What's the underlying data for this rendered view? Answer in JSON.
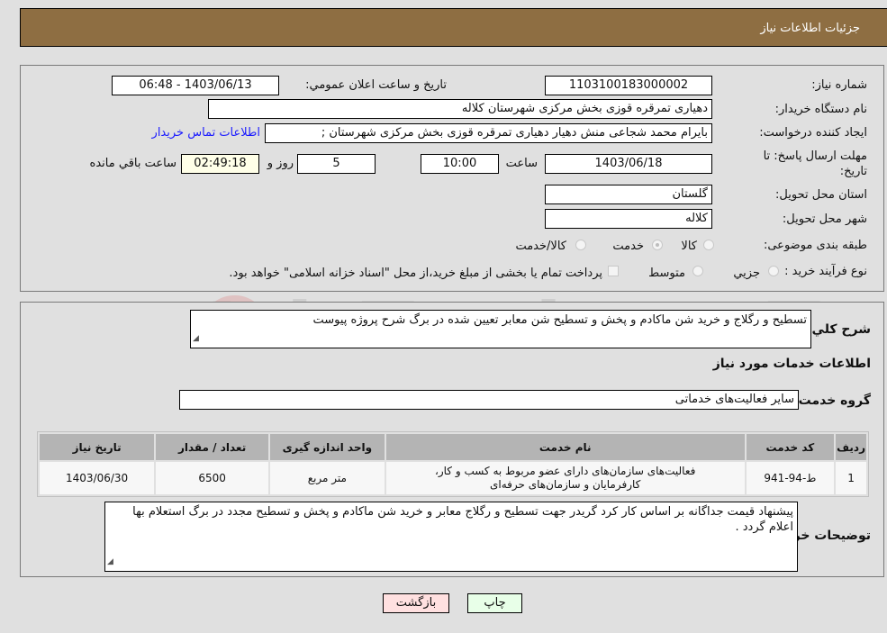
{
  "header": {
    "title": "جزئیات اطلاعات نیاز"
  },
  "info": {
    "need_number_label": "شماره نیاز:",
    "need_number": "1103100183000002",
    "announce_label": "تاریخ و ساعت اعلان عمومي:",
    "announce_value": "1403/06/13 - 06:48",
    "buyer_org_label": "نام دستگاه خریدار:",
    "buyer_org": "دهیاری تمرقره قوزی بخش مرکزی شهرستان کلاله",
    "creator_label": "ایجاد کننده درخواست:",
    "creator": "بایرام محمد شجاعی منش دهیار دهیاری تمرقره قوزی بخش مرکزی شهرستان ;",
    "contact_link": "اطلاعات تماس خریدار",
    "deadline_label": "مهلت ارسال پاسخ: تا تاریخ:",
    "deadline_date": "1403/06/18",
    "time_label": "ساعت",
    "deadline_time": "10:00",
    "days_value": "5",
    "days_label": "روز و",
    "remaining_time": "02:49:18",
    "remaining_label": "ساعت باقي مانده",
    "province_label": "استان محل تحویل:",
    "province": "گلستان",
    "city_label": "شهر محل تحویل:",
    "city": "کلاله",
    "category_label": "طبقه بندی موضوعی:",
    "category_options": [
      "کالا",
      "خدمت",
      "کالا/خدمت"
    ],
    "category_selected": "خدمت",
    "process_label": "نوع فرآیند خرید :",
    "process_options": [
      "جزيي",
      "متوسط"
    ],
    "payment_note": "پرداخت تمام یا بخشی از مبلغ خرید،از محل \"اسناد خزانه اسلامی\" خواهد بود."
  },
  "details": {
    "description_label": "شرح كلي نياز:",
    "description": "تسطیح و رگلاج  و خرید شن ماکادم  و پخش و تسطیح شن معابر تعیین شده در برگ شرح پروژه پیوست",
    "services_heading": "اطلاعات خدمات مورد نياز",
    "service_group_label": "گروه خدمت:",
    "service_group": "سایر فعالیت‌های خدماتی",
    "table": {
      "headers": [
        "ردیف",
        "کد خدمت",
        "نام خدمت",
        "واحد اندازه گیری",
        "تعداد / مقدار",
        "تاریخ نیاز"
      ],
      "rows": [
        [
          "1",
          "ط-94-941",
          "فعالیت‌های سازمان‌های دارای عضو مربوط به کسب و کار، کارفرمایان و سازمان‌های حرفه‌ای",
          "متر مربع",
          "6500",
          "1403/06/30"
        ]
      ]
    },
    "buyer_notes_label": "توضیحات خریدار:",
    "buyer_notes": "پیشنهاد قیمت جداگانه بر اساس کار کرد گریدر جهت تسطیح و رگلاج معابر و خرید شن ماکادم و پخش و تسطیح مجدد در برگ استعلام بها اعلام گردد ."
  },
  "buttons": {
    "print": "چاپ",
    "back": "بازگشت"
  },
  "watermark": "AriaTender.neT",
  "colors": {
    "header_bg": "#8e6e42",
    "print_bg": "#e8ffe8",
    "back_bg": "#ffe0e0",
    "link": "#1a1aff"
  }
}
